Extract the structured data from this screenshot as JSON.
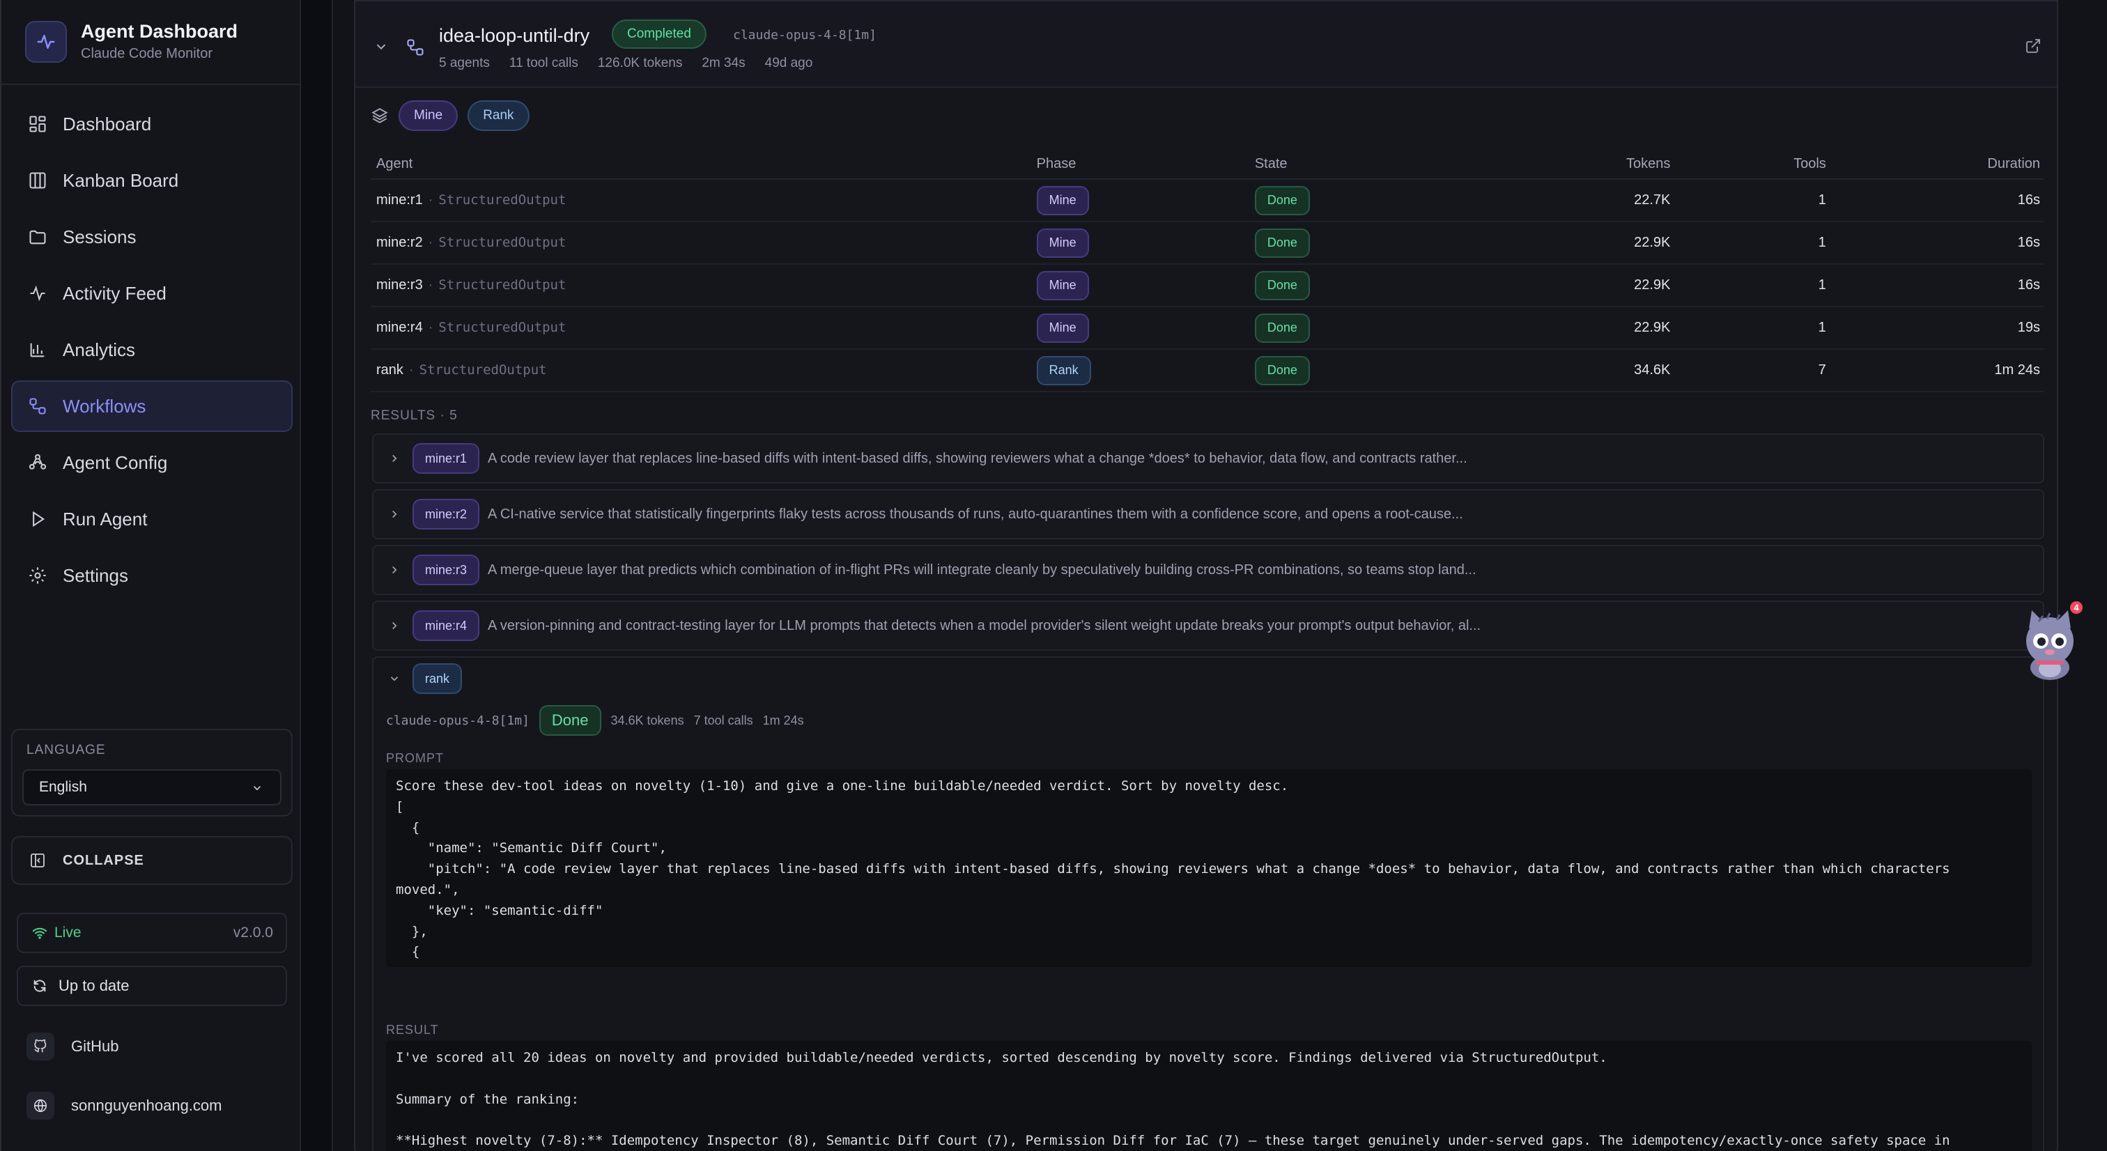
{
  "app": {
    "title": "Agent Dashboard",
    "subtitle": "Claude Code Monitor"
  },
  "nav": [
    {
      "label": "Dashboard",
      "icon": "dashboard-icon"
    },
    {
      "label": "Kanban Board",
      "icon": "kanban-icon"
    },
    {
      "label": "Sessions",
      "icon": "folder-icon"
    },
    {
      "label": "Activity Feed",
      "icon": "activity-icon"
    },
    {
      "label": "Analytics",
      "icon": "bar-chart-icon"
    },
    {
      "label": "Workflows",
      "icon": "workflow-icon",
      "active": true
    },
    {
      "label": "Agent Config",
      "icon": "agent-icon"
    },
    {
      "label": "Run Agent",
      "icon": "play-icon"
    },
    {
      "label": "Settings",
      "icon": "gear-icon"
    }
  ],
  "language": {
    "label": "LANGUAGE",
    "value": "English"
  },
  "collapse_label": "COLLAPSE",
  "status": {
    "live": "Live",
    "version": "v2.0.0",
    "update": "Up to date"
  },
  "links": {
    "github": "GitHub",
    "website": "sonnguyenhoang.com"
  },
  "workflow": {
    "name": "idea-loop-until-dry",
    "status": "Completed",
    "model": "claude-opus-4-8[1m]",
    "meta": [
      "5 agents",
      "11 tool calls",
      "126.0K tokens",
      "2m 34s",
      "49d ago"
    ],
    "phases": [
      "Mine",
      "Rank"
    ]
  },
  "table": {
    "headers": {
      "agent": "Agent",
      "phase": "Phase",
      "state": "State",
      "tokens": "Tokens",
      "tools": "Tools",
      "duration": "Duration"
    },
    "rows": [
      {
        "agent": "mine:r1",
        "tool": "StructuredOutput",
        "phase": "Mine",
        "state": "Done",
        "tokens": "22.7K",
        "tools": "1",
        "duration": "16s"
      },
      {
        "agent": "mine:r2",
        "tool": "StructuredOutput",
        "phase": "Mine",
        "state": "Done",
        "tokens": "22.9K",
        "tools": "1",
        "duration": "16s"
      },
      {
        "agent": "mine:r3",
        "tool": "StructuredOutput",
        "phase": "Mine",
        "state": "Done",
        "tokens": "22.9K",
        "tools": "1",
        "duration": "16s"
      },
      {
        "agent": "mine:r4",
        "tool": "StructuredOutput",
        "phase": "Mine",
        "state": "Done",
        "tokens": "22.9K",
        "tools": "1",
        "duration": "19s"
      },
      {
        "agent": "rank",
        "tool": "StructuredOutput",
        "phase": "Rank",
        "state": "Done",
        "tokens": "34.6K",
        "tools": "7",
        "duration": "1m 24s"
      }
    ]
  },
  "results": {
    "label": "RESULTS · 5",
    "items": [
      {
        "agent": "mine:r1",
        "text": "A code review layer that replaces line-based diffs with intent-based diffs, showing reviewers what a change *does* to behavior, data flow, and contracts rather..."
      },
      {
        "agent": "mine:r2",
        "text": "A CI-native service that statistically fingerprints flaky tests across thousands of runs, auto-quarantines them with a confidence score, and opens a root-cause..."
      },
      {
        "agent": "mine:r3",
        "text": "A merge-queue layer that predicts which combination of in-flight PRs will integrate cleanly by speculatively building cross-PR combinations, so teams stop land..."
      },
      {
        "agent": "mine:r4",
        "text": "A version-pinning and contract-testing layer for LLM prompts that detects when a model provider's silent weight update breaks your prompt's output behavior, al..."
      }
    ]
  },
  "rank_detail": {
    "agent": "rank",
    "model": "claude-opus-4-8[1m]",
    "state": "Done",
    "tokens": "34.6K tokens",
    "tool_calls": "7 tool calls",
    "duration": "1m 24s",
    "prompt_label": "PROMPT",
    "prompt_text": "Score these dev-tool ideas on novelty (1-10) and give a one-line buildable/needed verdict. Sort by novelty desc.\n[\n  {\n    \"name\": \"Semantic Diff Court\",\n    \"pitch\": \"A code review layer that replaces line-based diffs with intent-based diffs, showing reviewers what a change *does* to behavior, data flow, and contracts rather than which characters\nmoved.\",\n    \"key\": \"semantic-diff\"\n  },\n  {\n    \"name\": \"Replay\",\n    \"pitch\": \"A production-to-test pipeline that captures sanitized real request traces from prod and auto-generates deterministic, replayable integration tests so your test suite mirrors actual",
    "result_label": "RESULT",
    "result_text": "I've scored all 20 ideas on novelty and provided buildable/needed verdicts, sorted descending by novelty score. Findings delivered via StructuredOutput.\n\nSummary of the ranking:\n\n**Highest novelty (7-8):** Idempotency Inspector (8), Semantic Diff Court (7), Permission Diff for IaC (7) — these target genuinely under-served gaps. The idempotency/exactly-once safety space in"
  },
  "mascot_badge": "4",
  "colors": {
    "accent": "#8b8ff7",
    "success": "#63e0a2",
    "mine": "#cfc3ff",
    "rank": "#a6ccf5",
    "live": "#4cd38a"
  }
}
